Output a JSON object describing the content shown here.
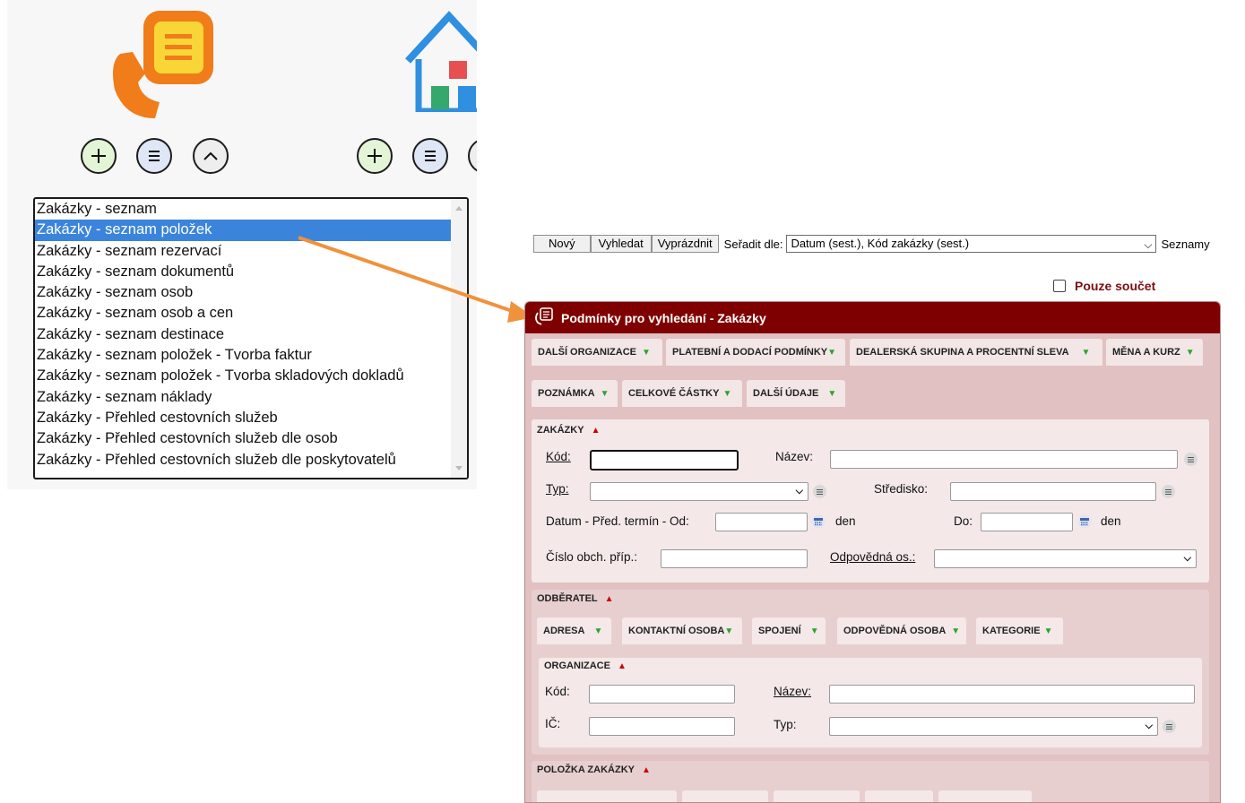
{
  "listbox": {
    "items": [
      "Zakázky - seznam",
      "Zakázky - seznam položek",
      "Zakázky - seznam rezervací",
      "Zakázky - seznam dokumentů",
      "Zakázky - seznam osob",
      "Zakázky - seznam osob a cen",
      "Zakázky - seznam destinace",
      "Zakázky - seznam položek - Tvorba faktur",
      "Zakázky - seznam položek - Tvorba skladových dokladů",
      "Zakázky - seznam náklady",
      "Zakázky - Přehled cestovních služeb",
      "Zakázky - Přehled cestovních služeb dle osob",
      "Zakázky - Přehled cestovních služeb dle poskytovatelů"
    ],
    "selected_index": 1
  },
  "toolbar": {
    "new_label": "Nový",
    "search_label": "Vyhledat",
    "clear_label": "Vyprázdnit",
    "sort_label": "Seřadit dle:",
    "sort_value": "Datum (sest.), Kód zakázky (sest.)",
    "lists_label": "Seznamy"
  },
  "only_sum": {
    "label": "Pouze součet",
    "checked": false
  },
  "form": {
    "title": "Podmínky pro vyhledání - Zakázky",
    "tabs_row1": [
      "DALŠÍ ORGANIZACE",
      "PLATEBNÍ A DODACÍ PODMÍNKY",
      "DEALERSKÁ SKUPINA A PROCENTNÍ SLEVA",
      "MĚNA A KURZ"
    ],
    "tabs_row2": [
      "POZNÁMKA",
      "CELKOVÉ ČÁSTKY",
      "DALŠÍ ÚDAJE"
    ],
    "zakazky": {
      "title": "ZAKÁZKY",
      "kod_label": "Kód:",
      "nazev_label": "Název:",
      "typ_label": "Typ:",
      "stredisko_label": "Středisko:",
      "datum_label": "Datum - Před. termín - Od:",
      "den1": "den",
      "do_label": "Do:",
      "den2": "den",
      "cislo_label": "Číslo obch. příp.:",
      "odpovedna_label": "Odpovědná os.:"
    },
    "odberatel": {
      "title": "ODBĚRATEL",
      "tabs": [
        "ADRESA",
        "KONTAKTNÍ OSOBA",
        "SPOJENÍ",
        "ODPOVĚDNÁ OSOBA",
        "KATEGORIE"
      ],
      "organizace": {
        "title": "ORGANIZACE",
        "kod_label": "Kód:",
        "nazev_label": "Název:",
        "ic_label": "IČ:",
        "typ_label": "Typ:"
      }
    },
    "polozka": {
      "title": "POLOŽKA ZAKÁZKY"
    }
  },
  "colors": {
    "header_bg": "#7f0000",
    "panel_bg": "#e1c1c1",
    "selected_item": "#3a84dc",
    "arrow": "#f0913c",
    "phone_orange": "#f07c1a",
    "house_blue": "#2f8fe0"
  }
}
